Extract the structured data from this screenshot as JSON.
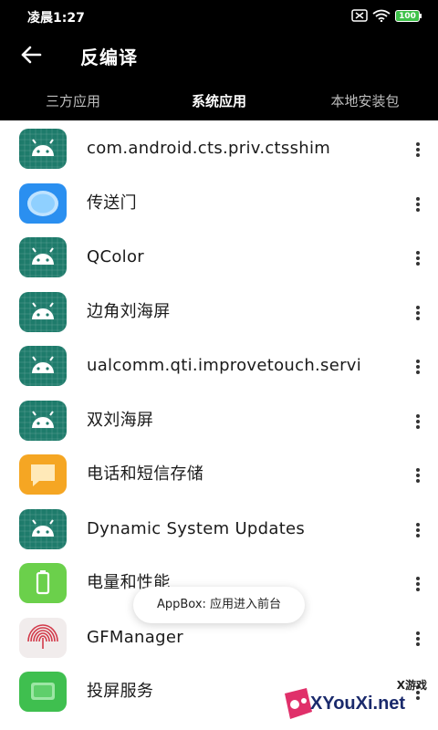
{
  "status_bar": {
    "time": "凌晨1:27",
    "battery": "100"
  },
  "header": {
    "title": "反编译",
    "back_icon": "arrow-left-icon"
  },
  "tabs": [
    {
      "label": "三方应用",
      "active": false
    },
    {
      "label": "系统应用",
      "active": true
    },
    {
      "label": "本地安装包",
      "active": false
    }
  ],
  "apps": [
    {
      "name": "com.android.cts.priv.ctsshim",
      "icon": "android-icon"
    },
    {
      "name": "传送门",
      "icon": "portal-icon"
    },
    {
      "name": "QColor",
      "icon": "android-icon"
    },
    {
      "name": "边角刘海屏",
      "icon": "android-icon"
    },
    {
      "name": "ualcomm.qti.improvetouch.servi",
      "icon": "android-icon"
    },
    {
      "name": "双刘海屏",
      "icon": "android-icon"
    },
    {
      "name": "电话和短信存储",
      "icon": "message-icon"
    },
    {
      "name": "Dynamic System Updates",
      "icon": "android-icon"
    },
    {
      "name": "电量和性能",
      "icon": "battery-app-icon"
    },
    {
      "name": "GFManager",
      "icon": "fingerprint-icon"
    },
    {
      "name": "投屏服务",
      "icon": "cast-icon"
    }
  ],
  "toast": "AppBox: 应用进入前台",
  "watermark": {
    "top": "X游戏",
    "main": "XYouXi.net"
  },
  "colors": {
    "header_bg": "#000000",
    "android_green": "#1e7b6b",
    "portal_blue": "#2a8ff0",
    "message_orange": "#f5a623",
    "battery_green": "#6bd04b",
    "cast_green": "#3fbf4f"
  }
}
